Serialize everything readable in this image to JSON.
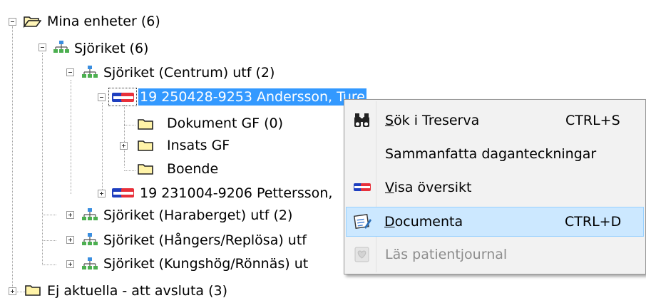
{
  "tree": {
    "root": "Mina enheter (6)",
    "unit": "Sjöriket (6)",
    "sub_centrum": "Sjöriket (Centrum) utf (2)",
    "patient1": "19 250428-9253 Andersson, Ture",
    "folder_dokument": "Dokument GF (0)",
    "folder_insats": "Insats GF",
    "folder_boende": "Boende",
    "patient2": "19 231004-9206 Pettersson,",
    "sub_haraberget": "Sjöriket (Haraberget) utf (2)",
    "sub_hangers": "Sjöriket (Hångers/Replösa) utf",
    "sub_kungshog": "Sjöriket (Kungshög/Rönnäs) ut",
    "ej_aktuella": "Ej aktuella - att avsluta (3)"
  },
  "context_menu": {
    "items": [
      {
        "label_prefix": "S",
        "label_rest": "ök i Treserva",
        "shortcut": "CTRL+S",
        "icon": "binoculars-icon"
      },
      {
        "label": "Sammanfatta daganteckningar",
        "shortcut": "",
        "icon": ""
      },
      {
        "label_prefix": "V",
        "label_rest": "isa översikt",
        "shortcut": "",
        "icon": "patient-card-icon"
      },
      {
        "label_prefix": "D",
        "label_rest": "ocumenta",
        "shortcut": "CTRL+D",
        "icon": "documenta-icon"
      },
      {
        "label": "Läs patientjournal",
        "shortcut": "",
        "icon": "journal-icon"
      }
    ]
  },
  "colors": {
    "selection": "#3399ff",
    "menu_bg": "#f2f2f2",
    "menu_hover": "#cce8ff",
    "disabled_text": "#8d8d8d"
  }
}
